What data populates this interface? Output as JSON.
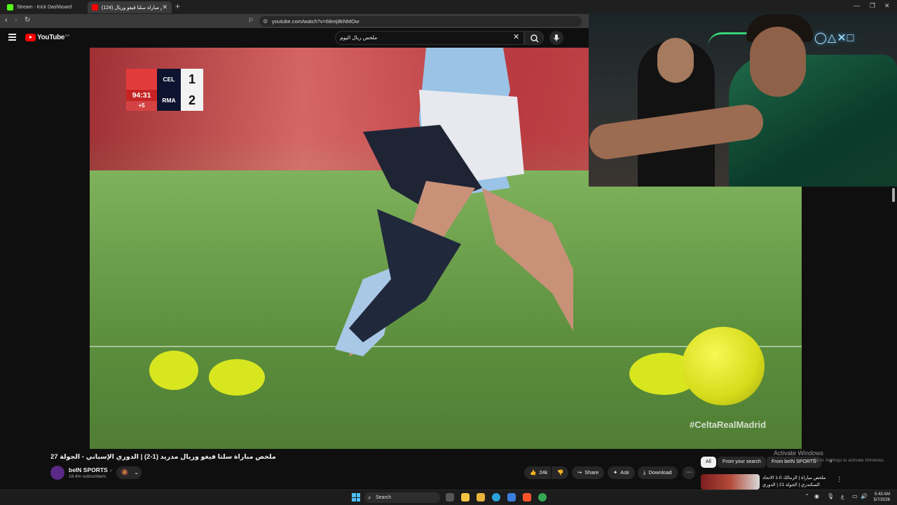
{
  "browser": {
    "tabs": [
      {
        "title": "Stream - Kick Dashboard",
        "favicon_color": "#53fc18"
      },
      {
        "title": "(124) ملخص مباراة سلتا فيغو وريال",
        "favicon_color": "#ff0000"
      }
    ],
    "new_tab": "+",
    "url": "youtube.com/watch?v=68rej8kNMOw",
    "window_controls": [
      "—",
      "❐",
      "✕"
    ]
  },
  "youtube": {
    "logo_text": "YouTube",
    "region": "ES",
    "search_query": "ملخص ريال اليوم"
  },
  "video": {
    "scoreboard": {
      "time": "94:31",
      "added": "+5",
      "teams": [
        {
          "abbr": "CEL",
          "score": "1"
        },
        {
          "abbr": "RMA",
          "score": "2"
        }
      ]
    },
    "hashtag": "#CeltaRealMadrid",
    "title": "ملخص مباراة سلتا فيغو وريال مدريد (1-2) | الدوري الإسباني - الجولة 27",
    "channel": {
      "name": "beIN SPORTS",
      "verified": "✓",
      "subscribers": "16.4m subscribers"
    },
    "actions": {
      "likes": "24k",
      "share": "Share",
      "ask": "Ask",
      "download": "Download",
      "more": "⋯"
    }
  },
  "sidebar": {
    "chips": [
      "All",
      "From your search",
      "From beIN SPORTS"
    ],
    "recommendation": {
      "title": "ملخص مباراة | الزمالك 0-1 الاتحاد السكندري | الجولة 21 | الدوري المصري"
    }
  },
  "watermark": {
    "line1": "Activate Windows",
    "line2": "Go to Settings to activate Windows."
  },
  "taskbar": {
    "search_label": "Search",
    "time": "5:43 AM",
    "date": "5/7/2026",
    "apps": [
      {
        "name": "file-explorer",
        "color": "#f4c542"
      },
      {
        "name": "edge",
        "color": "#2ba3d9"
      },
      {
        "name": "copilot",
        "color": "#7b61ff"
      },
      {
        "name": "mail",
        "color": "#3b7ddd"
      },
      {
        "name": "brave",
        "color": "#fb542b"
      },
      {
        "name": "chrome",
        "color": "#34a853"
      }
    ]
  }
}
